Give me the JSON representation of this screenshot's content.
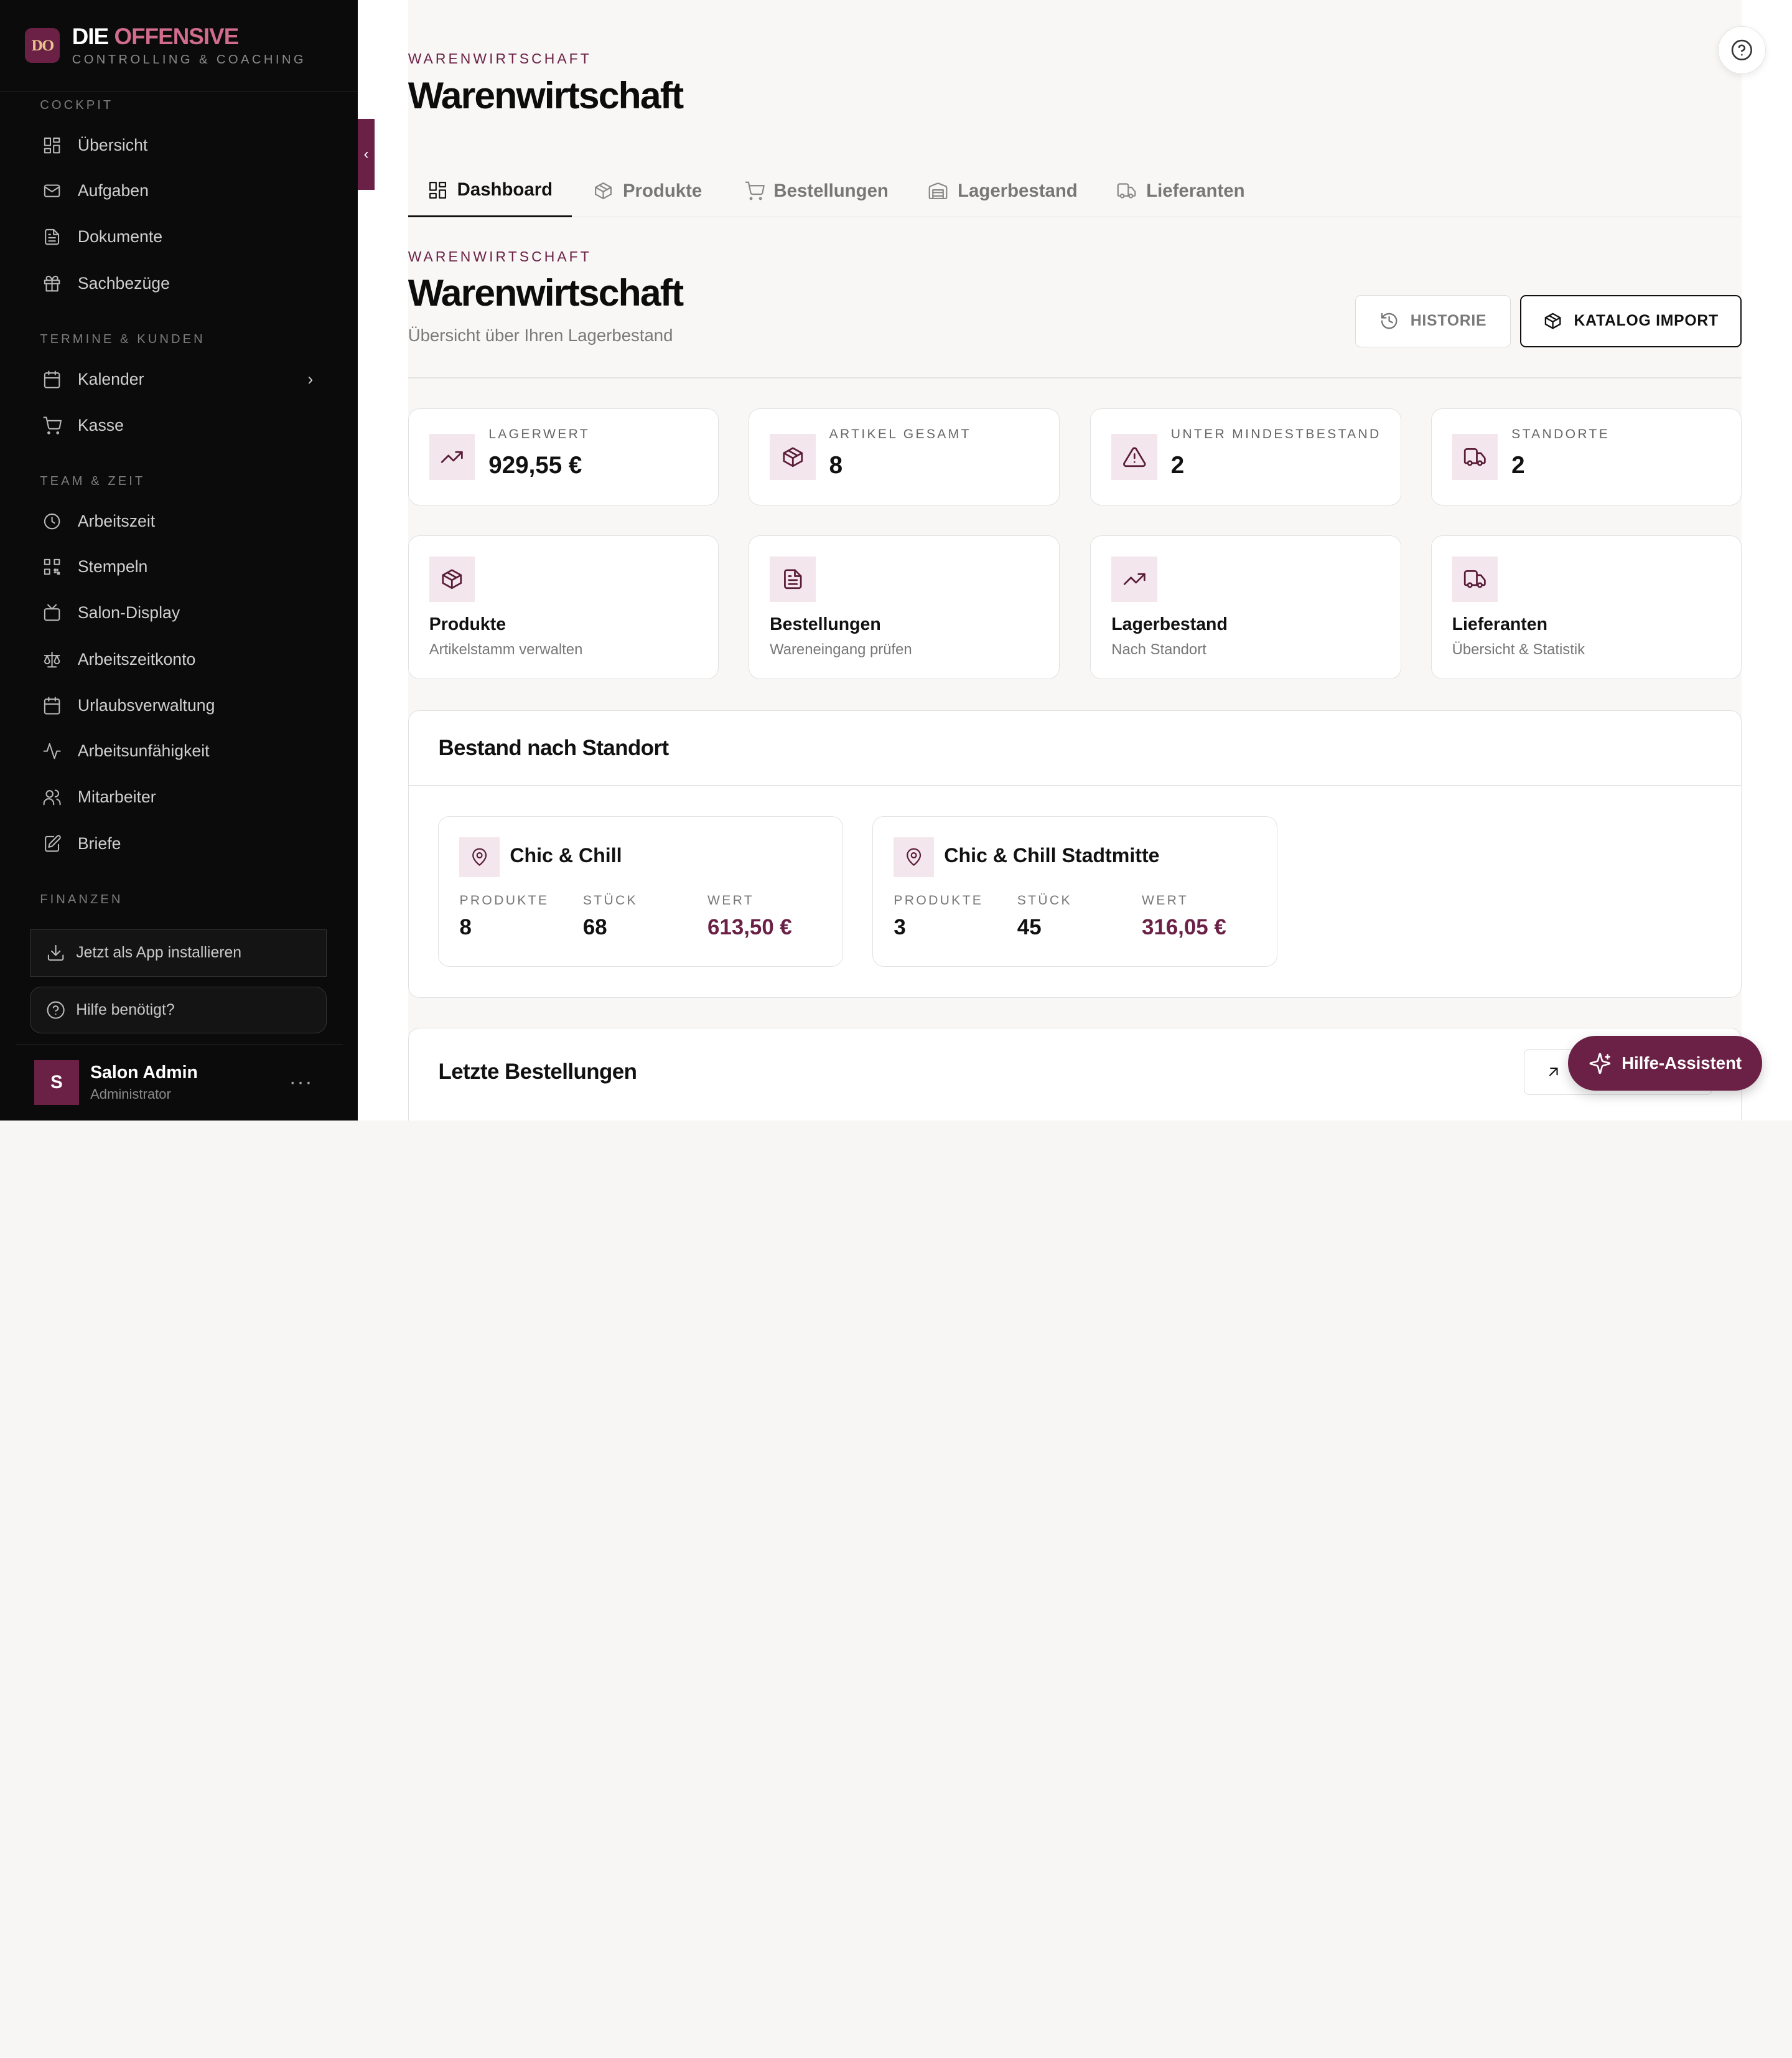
{
  "brand": {
    "logo": "DO",
    "title_a": "DIE",
    "title_b": "OFFENSIVE",
    "subtitle": "CONTROLLING & COACHING"
  },
  "sidebar": {
    "sections": [
      {
        "label": "COCKPIT"
      },
      {
        "label": "TERMINE & KUNDEN"
      },
      {
        "label": "TEAM & ZEIT"
      },
      {
        "label": "FINANZEN"
      }
    ],
    "items": [
      {
        "label": "Übersicht",
        "icon": "dashboard-icon"
      },
      {
        "label": "Aufgaben",
        "icon": "mail-icon"
      },
      {
        "label": "Dokumente",
        "icon": "document-icon"
      },
      {
        "label": "Sachbezüge",
        "icon": "gift-icon"
      },
      {
        "label": "Kalender",
        "icon": "calendar-icon"
      },
      {
        "label": "Kasse",
        "icon": "cart-icon"
      },
      {
        "label": "Arbeitszeit",
        "icon": "clock-icon"
      },
      {
        "label": "Stempeln",
        "icon": "qr-icon"
      },
      {
        "label": "Salon-Display",
        "icon": "tv-icon"
      },
      {
        "label": "Arbeitszeitkonto",
        "icon": "scale-icon"
      },
      {
        "label": "Urlaubsverwaltung",
        "icon": "calendar-icon"
      },
      {
        "label": "Arbeitsunfähigkeit",
        "icon": "activity-icon"
      },
      {
        "label": "Mitarbeiter",
        "icon": "users-icon"
      },
      {
        "label": "Briefe",
        "icon": "edit-icon"
      }
    ],
    "install_label": "Jetzt als App installieren",
    "help_label": "Hilfe benötigt?",
    "user": {
      "initial": "S",
      "name": "Salon Admin",
      "role": "Administrator",
      "menu": "···"
    }
  },
  "header": {
    "kicker": "WARENWIRTSCHAFT",
    "title": "Warenwirtschaft"
  },
  "tabs": [
    {
      "label": "Dashboard",
      "icon": "dashboard-icon",
      "active": true
    },
    {
      "label": "Produkte",
      "icon": "box-icon"
    },
    {
      "label": "Bestellungen",
      "icon": "cart-icon"
    },
    {
      "label": "Lagerbestand",
      "icon": "warehouse-icon"
    },
    {
      "label": "Lieferanten",
      "icon": "truck-icon"
    }
  ],
  "page": {
    "kicker": "WARENWIRTSCHAFT",
    "title": "Warenwirtschaft",
    "subtitle": "Übersicht über Ihren Lagerbestand",
    "btn_history": "HISTORIE",
    "btn_import": "KATALOG IMPORT"
  },
  "stats": [
    {
      "label": "LAGERWERT",
      "value": "929,55 €",
      "icon": "trending-up-icon"
    },
    {
      "label": "ARTIKEL GESAMT",
      "value": "8",
      "icon": "box-icon"
    },
    {
      "label": "UNTER MINDESTBESTAND",
      "value": "2",
      "icon": "warning-icon"
    },
    {
      "label": "STANDORTE",
      "value": "2",
      "icon": "truck-icon"
    }
  ],
  "quick": [
    {
      "title": "Produkte",
      "desc": "Artikelstamm verwalten",
      "icon": "box-icon"
    },
    {
      "title": "Bestellungen",
      "desc": "Wareneingang prüfen",
      "icon": "document-icon"
    },
    {
      "title": "Lagerbestand",
      "desc": "Nach Standort",
      "icon": "trending-up-icon"
    },
    {
      "title": "Lieferanten",
      "desc": "Übersicht & Statistik",
      "icon": "truck-icon"
    }
  ],
  "locations_panel": {
    "title": "Bestand nach Standort",
    "col_products": "PRODUKTE",
    "col_pieces": "STÜCK",
    "col_value": "WERT",
    "items": [
      {
        "name": "Chic & Chill",
        "products": "8",
        "pieces": "68",
        "value": "613,50 €"
      },
      {
        "name": "Chic & Chill Stadtmitte",
        "products": "3",
        "pieces": "45",
        "value": "316,05 €"
      }
    ]
  },
  "orders_panel": {
    "title": "Letzte Bestellungen"
  },
  "assistant": {
    "label": "Hilfe-Assistent"
  },
  "colors": {
    "brand": "#6b2146",
    "sidebar_bg": "#0b0b0b",
    "icon_bg": "#f3e6ec",
    "accent_text": "#d16c8d"
  }
}
